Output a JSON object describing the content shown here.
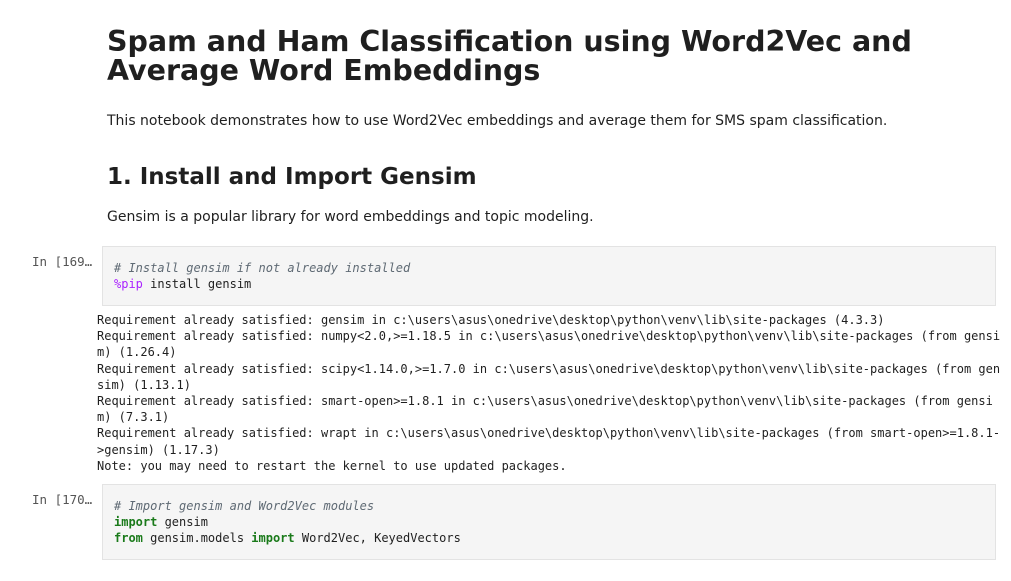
{
  "notebook": {
    "title": "Spam and Ham Classification using Word2Vec and Average Word Embeddings",
    "intro": "This notebook demonstrates how to use Word2Vec embeddings and average them for SMS spam classification.",
    "section1_heading": "1. Install and Import Gensim",
    "section1_text": "Gensim is a popular library for word embeddings and topic modeling."
  },
  "cells": [
    {
      "prompt": "In [169…",
      "lines": {
        "comment": "# Install gensim if not already installed",
        "magic": "%pip",
        "rest": " install gensim"
      },
      "output": [
        "Requirement already satisfied: gensim in c:\\users\\asus\\onedrive\\desktop\\python\\venv\\lib\\site-packages (4.3.3)",
        "Requirement already satisfied: numpy<2.0,>=1.18.5 in c:\\users\\asus\\onedrive\\desktop\\python\\venv\\lib\\site-packages (from gensi",
        "m) (1.26.4)",
        "Requirement already satisfied: scipy<1.14.0,>=1.7.0 in c:\\users\\asus\\onedrive\\desktop\\python\\venv\\lib\\site-packages (from gen",
        "sim) (1.13.1)",
        "Requirement already satisfied: smart-open>=1.8.1 in c:\\users\\asus\\onedrive\\desktop\\python\\venv\\lib\\site-packages (from gensi",
        "m) (7.3.1)",
        "Requirement already satisfied: wrapt in c:\\users\\asus\\onedrive\\desktop\\python\\venv\\lib\\site-packages (from smart-open>=1.8.1-",
        ">gensim) (1.17.3)",
        "Note: you may need to restart the kernel to use updated packages."
      ]
    },
    {
      "prompt": "In [170…",
      "lines": {
        "comment": "# Import gensim and Word2Vec modules",
        "kw1": "import",
        "l2rest": " gensim",
        "kw2": "from",
        "l3mid": " gensim.models ",
        "kw3": "import",
        "l3rest": " Word2Vec, KeyedVectors"
      }
    }
  ]
}
